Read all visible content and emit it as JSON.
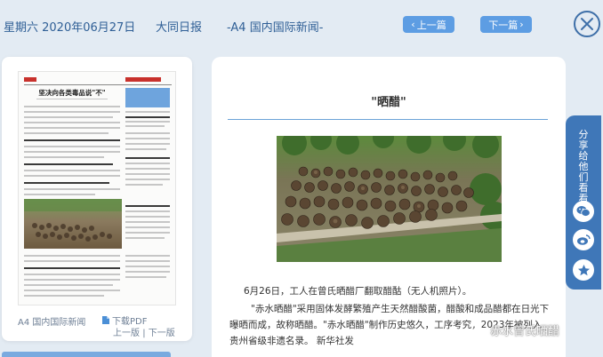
{
  "header": {
    "date": "星期六 2020年06月27日",
    "paper": "大同日报",
    "section": "-A4 国内国际新闻-",
    "prev_label": "上一篇",
    "next_label": "下一篇"
  },
  "left_panel": {
    "thumb_headline": "坚决向各类毒品说\"不\"",
    "page_label": "A4 国内国际新闻",
    "pdf_label": "下载PDF",
    "prev_page": "上一版",
    "separator": "|",
    "next_page": "下一版"
  },
  "article": {
    "title": "\"晒醋\"",
    "caption": "6月26日，工人在曾氏晒醋厂翻取醋酤（无人机照片）。",
    "body": "\"赤水晒醋\"采用固体发酵繁殖产生天然醋酸菌，醋酸和成品醋都在日光下曝晒而成，故称晒醋。\"赤水晒醋\"制作历史悠久，工序考究，2023年被列入贵州省级非遗名录。 新华社发"
  },
  "share": {
    "label": "分享给他们看看",
    "icons": [
      "wechat-icon",
      "weibo-icon",
      "favorite-icon"
    ]
  },
  "watermark": {
    "text": "赤水曾氏晒醋"
  },
  "colors": {
    "accent": "#5d9de3",
    "header_text": "#2f5f96",
    "share_bg": "#3f77b8",
    "background": "#e3ebf3"
  }
}
